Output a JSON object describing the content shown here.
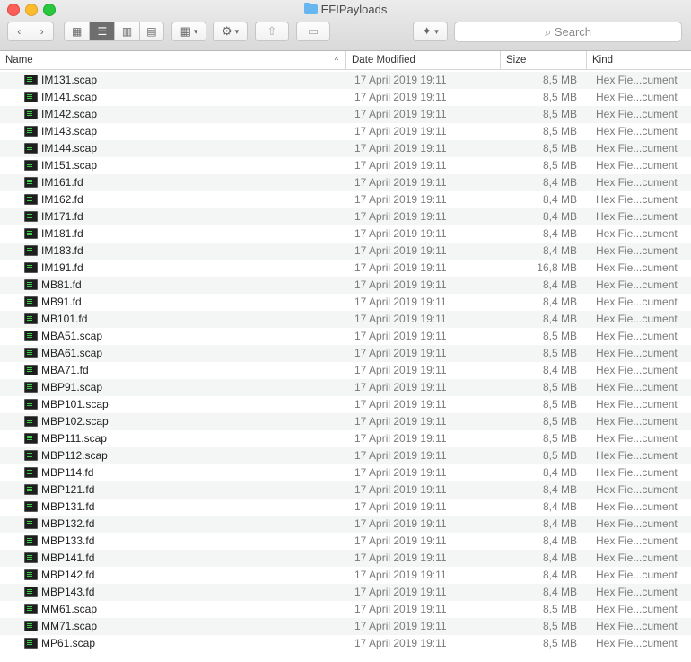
{
  "window": {
    "title": "EFIPayloads"
  },
  "search": {
    "placeholder": "Search"
  },
  "columns": {
    "name": "Name",
    "date": "Date Modified",
    "size": "Size",
    "kind": "Kind"
  },
  "files": [
    {
      "name": "IM131.scap",
      "date": "17 April 2019 19:11",
      "size": "8,5 MB",
      "kind": "Hex Fie...cument"
    },
    {
      "name": "IM141.scap",
      "date": "17 April 2019 19:11",
      "size": "8,5 MB",
      "kind": "Hex Fie...cument"
    },
    {
      "name": "IM142.scap",
      "date": "17 April 2019 19:11",
      "size": "8,5 MB",
      "kind": "Hex Fie...cument"
    },
    {
      "name": "IM143.scap",
      "date": "17 April 2019 19:11",
      "size": "8,5 MB",
      "kind": "Hex Fie...cument"
    },
    {
      "name": "IM144.scap",
      "date": "17 April 2019 19:11",
      "size": "8,5 MB",
      "kind": "Hex Fie...cument"
    },
    {
      "name": "IM151.scap",
      "date": "17 April 2019 19:11",
      "size": "8,5 MB",
      "kind": "Hex Fie...cument"
    },
    {
      "name": "IM161.fd",
      "date": "17 April 2019 19:11",
      "size": "8,4 MB",
      "kind": "Hex Fie...cument"
    },
    {
      "name": "IM162.fd",
      "date": "17 April 2019 19:11",
      "size": "8,4 MB",
      "kind": "Hex Fie...cument"
    },
    {
      "name": "IM171.fd",
      "date": "17 April 2019 19:11",
      "size": "8,4 MB",
      "kind": "Hex Fie...cument"
    },
    {
      "name": "IM181.fd",
      "date": "17 April 2019 19:11",
      "size": "8,4 MB",
      "kind": "Hex Fie...cument"
    },
    {
      "name": "IM183.fd",
      "date": "17 April 2019 19:11",
      "size": "8,4 MB",
      "kind": "Hex Fie...cument"
    },
    {
      "name": "IM191.fd",
      "date": "17 April 2019 19:11",
      "size": "16,8 MB",
      "kind": "Hex Fie...cument"
    },
    {
      "name": "MB81.fd",
      "date": "17 April 2019 19:11",
      "size": "8,4 MB",
      "kind": "Hex Fie...cument"
    },
    {
      "name": "MB91.fd",
      "date": "17 April 2019 19:11",
      "size": "8,4 MB",
      "kind": "Hex Fie...cument"
    },
    {
      "name": "MB101.fd",
      "date": "17 April 2019 19:11",
      "size": "8,4 MB",
      "kind": "Hex Fie...cument"
    },
    {
      "name": "MBA51.scap",
      "date": "17 April 2019 19:11",
      "size": "8,5 MB",
      "kind": "Hex Fie...cument"
    },
    {
      "name": "MBA61.scap",
      "date": "17 April 2019 19:11",
      "size": "8,5 MB",
      "kind": "Hex Fie...cument"
    },
    {
      "name": "MBA71.fd",
      "date": "17 April 2019 19:11",
      "size": "8,4 MB",
      "kind": "Hex Fie...cument"
    },
    {
      "name": "MBP91.scap",
      "date": "17 April 2019 19:11",
      "size": "8,5 MB",
      "kind": "Hex Fie...cument"
    },
    {
      "name": "MBP101.scap",
      "date": "17 April 2019 19:11",
      "size": "8,5 MB",
      "kind": "Hex Fie...cument"
    },
    {
      "name": "MBP102.scap",
      "date": "17 April 2019 19:11",
      "size": "8,5 MB",
      "kind": "Hex Fie...cument"
    },
    {
      "name": "MBP111.scap",
      "date": "17 April 2019 19:11",
      "size": "8,5 MB",
      "kind": "Hex Fie...cument"
    },
    {
      "name": "MBP112.scap",
      "date": "17 April 2019 19:11",
      "size": "8,5 MB",
      "kind": "Hex Fie...cument"
    },
    {
      "name": "MBP114.fd",
      "date": "17 April 2019 19:11",
      "size": "8,4 MB",
      "kind": "Hex Fie...cument"
    },
    {
      "name": "MBP121.fd",
      "date": "17 April 2019 19:11",
      "size": "8,4 MB",
      "kind": "Hex Fie...cument"
    },
    {
      "name": "MBP131.fd",
      "date": "17 April 2019 19:11",
      "size": "8,4 MB",
      "kind": "Hex Fie...cument"
    },
    {
      "name": "MBP132.fd",
      "date": "17 April 2019 19:11",
      "size": "8,4 MB",
      "kind": "Hex Fie...cument"
    },
    {
      "name": "MBP133.fd",
      "date": "17 April 2019 19:11",
      "size": "8,4 MB",
      "kind": "Hex Fie...cument"
    },
    {
      "name": "MBP141.fd",
      "date": "17 April 2019 19:11",
      "size": "8,4 MB",
      "kind": "Hex Fie...cument"
    },
    {
      "name": "MBP142.fd",
      "date": "17 April 2019 19:11",
      "size": "8,4 MB",
      "kind": "Hex Fie...cument"
    },
    {
      "name": "MBP143.fd",
      "date": "17 April 2019 19:11",
      "size": "8,4 MB",
      "kind": "Hex Fie...cument"
    },
    {
      "name": "MM61.scap",
      "date": "17 April 2019 19:11",
      "size": "8,5 MB",
      "kind": "Hex Fie...cument"
    },
    {
      "name": "MM71.scap",
      "date": "17 April 2019 19:11",
      "size": "8,5 MB",
      "kind": "Hex Fie...cument"
    },
    {
      "name": "MP61.scap",
      "date": "17 April 2019 19:11",
      "size": "8,5 MB",
      "kind": "Hex Fie...cument"
    }
  ]
}
